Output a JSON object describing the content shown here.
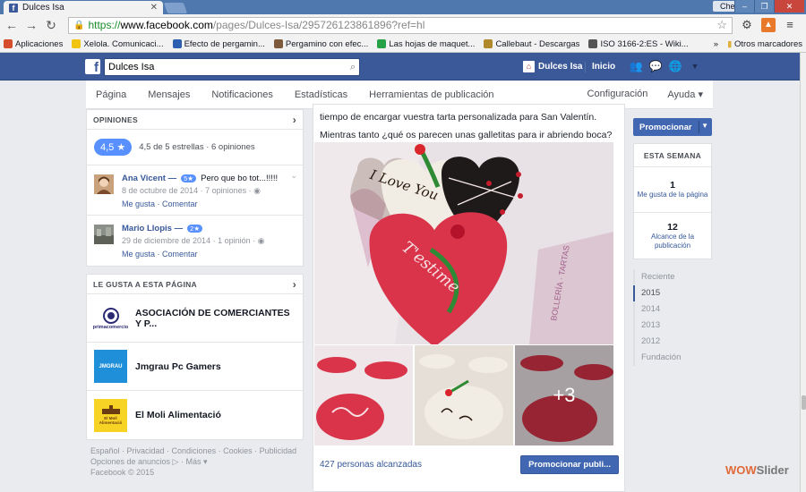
{
  "browser": {
    "tab_title": "Dulces Isa",
    "window_user": "Chelo",
    "url_scheme": "https://",
    "url_host": "www.facebook.com",
    "url_path": "/pages/Dulces-Isa/295726123861896?ref=hl",
    "bookmarks": [
      {
        "label": "Aplicaciones",
        "color": "#d54d2c"
      },
      {
        "label": "Xelola. Comunicaci...",
        "color": "#f1c40f"
      },
      {
        "label": "Efecto de pergamin...",
        "color": "#2d5fb0"
      },
      {
        "label": "Pergamino con efec...",
        "color": "#7d5a3c"
      },
      {
        "label": "Las hojas de maquet...",
        "color": "#27a146"
      },
      {
        "label": "Callebaut - Descargas",
        "color": "#b08a2a"
      },
      {
        "label": "ISO 3166-2:ES - Wiki...",
        "color": "#555555"
      }
    ],
    "bookmarks_overflow": "»",
    "other_bookmarks": "Otros marcadores"
  },
  "fb": {
    "search_value": "Dulces Isa",
    "user_name": "Dulces Isa",
    "home": "Inicio"
  },
  "page_nav": {
    "items": [
      "Página",
      "Mensajes",
      "Notificaciones",
      "Estadísticas",
      "Herramientas de publicación"
    ],
    "config": "Configuración",
    "help": "Ayuda ▾"
  },
  "reviews_card": {
    "title": "OPINIONES",
    "rating": "4,5 ★",
    "summary": "4,5 de 5 estrellas · 6 opiniones",
    "reviews": [
      {
        "name": "Ana Vicent —",
        "stars": "5★",
        "text": "Pero que bo tot...!!!!!",
        "meta": "8 de octubre de 2014 · 7 opiniones · ◉",
        "actions": "Me gusta · Comentar"
      },
      {
        "name": "Mario Llopis —",
        "stars": "2★",
        "text": "",
        "meta": "29 de diciembre de 2014 · 1 opinión · ◉",
        "actions": "Me gusta · Comentar"
      }
    ]
  },
  "likes_card": {
    "title": "LE GUSTA A ESTA PÁGINA",
    "items": [
      {
        "name": "ASOCIACIÓN DE COMERCIANTES Y P...",
        "logo_text": "primacomercio"
      },
      {
        "name": "Jmgrau Pc Gamers",
        "logo_text": "JMGRAU"
      },
      {
        "name": "El Moli Alimentació",
        "logo_text": "El Molí Alimentació"
      }
    ]
  },
  "footer": {
    "line1": "Español · Privacidad · Condiciones · Cookies · Publicidad",
    "line2": "Opciones de anuncios ▷ · Más ▾",
    "line3": "Facebook © 2015"
  },
  "post": {
    "text_line1": "tiempo de encargar vuestra tarta personalizada para San Valentín.",
    "text_line2": "Mientras tanto ¿qué os parecen unas galletitas para ir abriendo boca?",
    "cookie1_text": "I Love You",
    "more_photos": "+3",
    "reach": "427 personas alcanzadas",
    "promote": "Promocionar publi..."
  },
  "right": {
    "promote_button": "Promocionar",
    "week_title": "ESTA SEMANA",
    "stats": [
      {
        "value": "1",
        "label": "Me gusta de la página"
      },
      {
        "value": "12",
        "label": "Alcance de la publicación"
      }
    ],
    "timeline": [
      "Reciente",
      "2015",
      "2014",
      "2013",
      "2012",
      "Fundación"
    ],
    "timeline_active": "2015"
  },
  "watermark": {
    "brand": "WOW",
    "suffix": "Slider"
  }
}
